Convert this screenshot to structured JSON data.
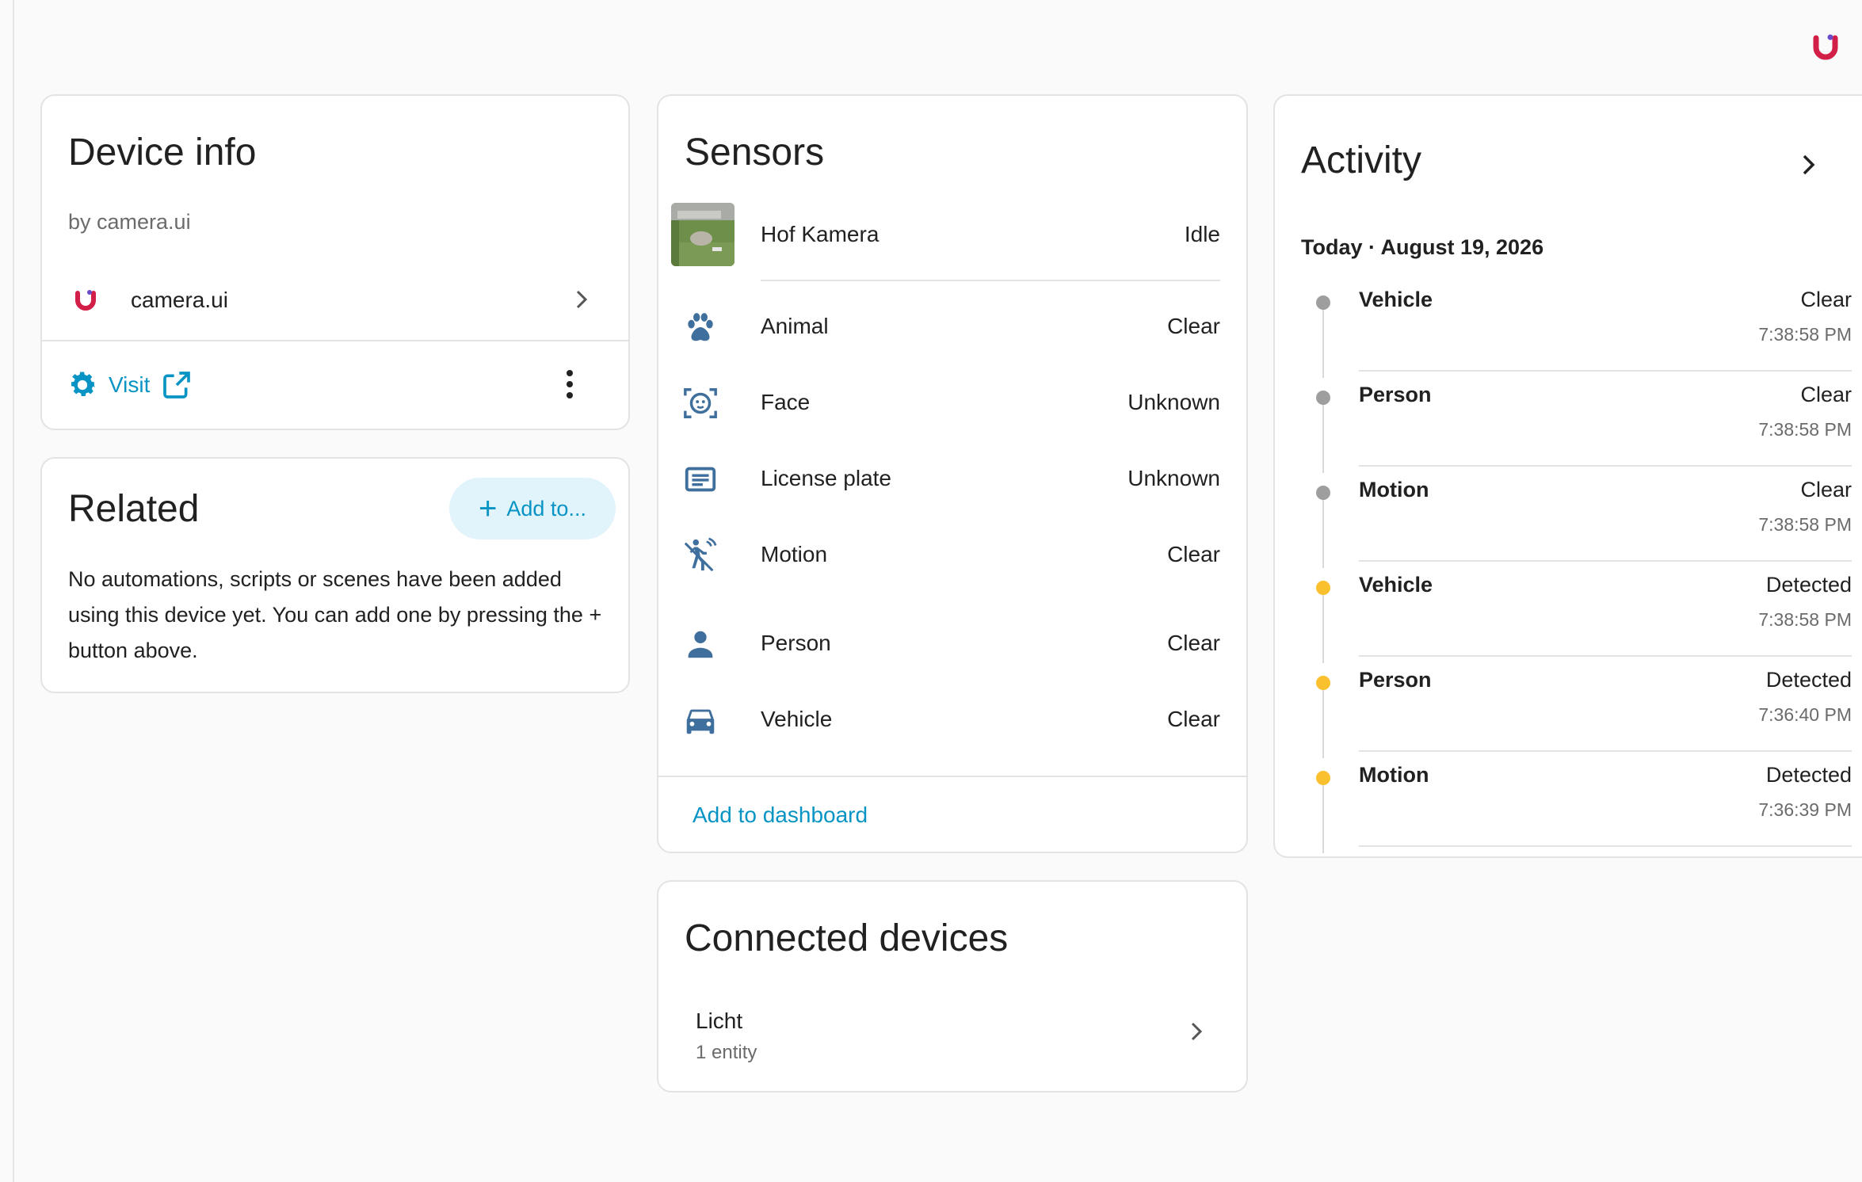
{
  "colors": {
    "accent": "#0794c4",
    "sensor_icon": "#3f6f9c",
    "dot_clear": "#9e9e9e",
    "dot_detected": "#fbc02d",
    "brand": "#d21f47"
  },
  "device_info": {
    "title": "Device info",
    "by_line": "by camera.ui",
    "integration": {
      "name": "camera.ui",
      "icon": "camera-ui-logo"
    },
    "visit_label": "Visit"
  },
  "related": {
    "title": "Related",
    "add_button": "Add to...",
    "text": "No automations, scripts or scenes have been added using this device yet. You can add one by pressing the + button above."
  },
  "sensors": {
    "title": "Sensors",
    "items": [
      {
        "name": "Hof Kamera",
        "state": "Idle",
        "icon": "camera-thumbnail"
      },
      {
        "name": "Animal",
        "state": "Clear",
        "icon": "paw-icon"
      },
      {
        "name": "Face",
        "state": "Unknown",
        "icon": "face-recognition-icon"
      },
      {
        "name": "License plate",
        "state": "Unknown",
        "icon": "card-text-icon"
      },
      {
        "name": "Motion",
        "state": "Clear",
        "icon": "motion-sensor-icon"
      },
      {
        "name": "Person",
        "state": "Clear",
        "icon": "person-icon"
      },
      {
        "name": "Vehicle",
        "state": "Clear",
        "icon": "car-icon"
      }
    ],
    "add_to_dashboard": "Add to dashboard"
  },
  "connected": {
    "title": "Connected devices",
    "items": [
      {
        "name": "Licht",
        "sub": "1 entity"
      }
    ]
  },
  "activity": {
    "title": "Activity",
    "date": "Today · August 19, 2026",
    "events": [
      {
        "name": "Vehicle",
        "state": "Clear",
        "time": "7:38:58 PM",
        "status": "clear"
      },
      {
        "name": "Person",
        "state": "Clear",
        "time": "7:38:58 PM",
        "status": "clear"
      },
      {
        "name": "Motion",
        "state": "Clear",
        "time": "7:38:58 PM",
        "status": "clear"
      },
      {
        "name": "Vehicle",
        "state": "Detected",
        "time": "7:38:58 PM",
        "status": "detected"
      },
      {
        "name": "Person",
        "state": "Detected",
        "time": "7:36:40 PM",
        "status": "detected"
      },
      {
        "name": "Motion",
        "state": "Detected",
        "time": "7:36:39 PM",
        "status": "detected"
      }
    ]
  }
}
